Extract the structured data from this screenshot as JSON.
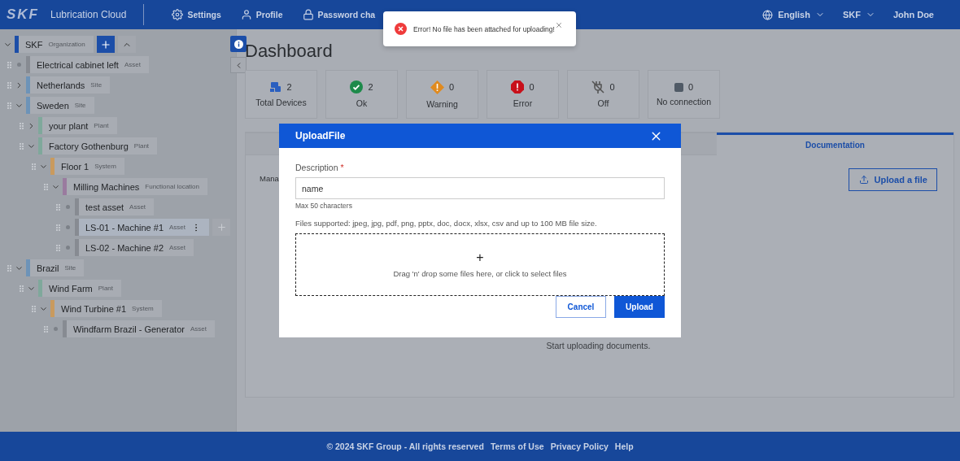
{
  "header": {
    "logo": "SKF",
    "app_name": "Lubrication Cloud",
    "nav": [
      {
        "kind": "settings",
        "label": "Settings"
      },
      {
        "kind": "profile",
        "label": "Profile"
      },
      {
        "kind": "password",
        "label": "Password cha"
      }
    ],
    "language": "English",
    "organization": "SKF",
    "user": "John Doe"
  },
  "toast": {
    "message": "Error! No file has been attached for uploading!"
  },
  "tree": {
    "name": "SKF",
    "type": "Organization",
    "color": "#1c4ea8",
    "expanded": true,
    "selected": false,
    "children": [
      {
        "name": "Electrical cabinet left",
        "type": "Asset",
        "color": "#878b92",
        "selected": false
      },
      {
        "name": "Netherlands",
        "type": "Site",
        "color": "#6d93b8",
        "expanded": false,
        "selected": false
      },
      {
        "name": "Sweden",
        "type": "Site",
        "color": "#6d93b8",
        "expanded": true,
        "selected": false,
        "children": [
          {
            "name": "your plant",
            "type": "Plant",
            "color": "#7fa89b",
            "expanded": false,
            "selected": false
          },
          {
            "name": "Factory Gothenburg",
            "type": "Plant",
            "color": "#7fa89b",
            "expanded": true,
            "selected": false,
            "children": [
              {
                "name": "Floor 1",
                "type": "System",
                "color": "#c99a5e",
                "expanded": true,
                "selected": false,
                "children": [
                  {
                    "name": "Milling Machines",
                    "type": "Functional location",
                    "color": "#9a7b9f",
                    "expanded": true,
                    "selected": false,
                    "children": [
                      {
                        "name": "test asset",
                        "type": "Asset",
                        "color": "#878b92",
                        "selected": false
                      },
                      {
                        "name": "LS-01 - Machine #1",
                        "type": "Asset",
                        "color": "#878b92",
                        "selected": true
                      },
                      {
                        "name": "LS-02 - Machine #2",
                        "type": "Asset",
                        "color": "#878b92",
                        "selected": false
                      }
                    ]
                  }
                ]
              }
            ]
          }
        ]
      },
      {
        "name": "Brazil",
        "type": "Site",
        "color": "#6d93b8",
        "expanded": true,
        "selected": false,
        "children": [
          {
            "name": "Wind Farm",
            "type": "Plant",
            "color": "#7fa89b",
            "expanded": true,
            "selected": false,
            "children": [
              {
                "name": "Wind Turbine #1",
                "type": "System",
                "color": "#c99a5e",
                "expanded": true,
                "selected": false,
                "children": [
                  {
                    "name": "Windfarm Brazil - Generator",
                    "type": "Asset",
                    "color": "#878b92",
                    "selected": false
                  }
                ]
              }
            ]
          }
        ]
      }
    ]
  },
  "page_title": "Dashboard",
  "stats": [
    {
      "kind": "devices",
      "count": "2",
      "label": "Total Devices"
    },
    {
      "kind": "ok",
      "count": "2",
      "label": "Ok"
    },
    {
      "kind": "warning",
      "count": "0",
      "label": "Warning"
    },
    {
      "kind": "error",
      "count": "0",
      "label": "Error"
    },
    {
      "kind": "off",
      "count": "0",
      "label": "Off"
    },
    {
      "kind": "none",
      "count": "0",
      "label": "No connection"
    }
  ],
  "tabs": [
    {
      "selected": false
    },
    {
      "label": "Documentation",
      "selected": true
    }
  ],
  "panel": {
    "heading": "Mana",
    "upload_button": "Upload a file",
    "empty_text": "Start uploading documents."
  },
  "dialog": {
    "title": "UploadFile",
    "field_label": "Description",
    "required_mark": "*",
    "value": "name",
    "hint": "Max 50 characters",
    "supported": "Files supported: jpeg, jpg, pdf, png, pptx, doc, docx, xlsx, csv and up to 100 MB file size.",
    "drop_icon": "+",
    "drop_text": "Drag 'n' drop some files here, or click to select files",
    "buttons": [
      {
        "kind": "secondary",
        "label": "Cancel"
      },
      {
        "kind": "primary",
        "label": "Upload"
      }
    ]
  },
  "footer": {
    "copyright": "© 2024 SKF Group - All rights reserved",
    "links": [
      "Terms of Use",
      "Privacy Policy",
      "Help"
    ]
  }
}
